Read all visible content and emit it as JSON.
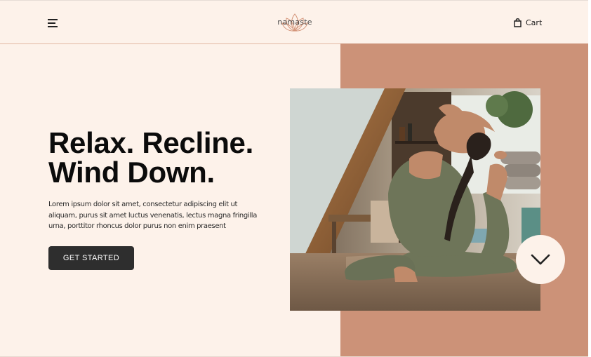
{
  "header": {
    "logo_text": "namaste",
    "cart_label": "Cart"
  },
  "hero": {
    "headline_line1": "Relax. Recline.",
    "headline_line2": "Wind Down.",
    "body_line1": "Lorem ipsum dolor sit amet, consectetur adipiscing elit ut",
    "body_line2": "aliquam, purus sit amet luctus venenatis, lectus magna fringilla",
    "body_line3": "urna, porttitor rhoncus dolor purus non enim praesent",
    "cta_label": "GET STARTED"
  },
  "icons": {
    "menu": "hamburger-menu-icon",
    "logo": "lotus-icon",
    "cart": "shopping-bag-icon",
    "scroll": "chevron-down-icon"
  },
  "colors": {
    "background": "#fdf2ea",
    "accent_panel": "#cc9278",
    "button": "#2e2e2e",
    "text": "#0b0b0b"
  }
}
